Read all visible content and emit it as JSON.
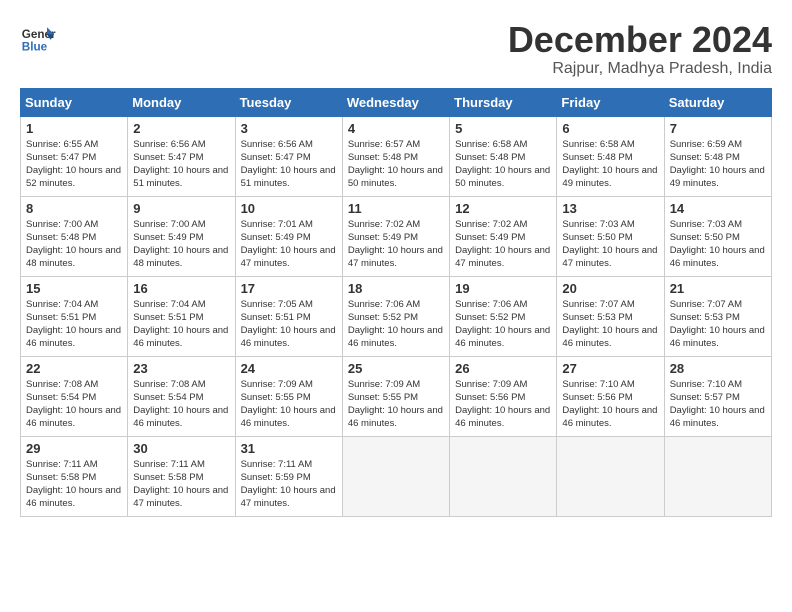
{
  "header": {
    "logo_line1": "General",
    "logo_line2": "Blue",
    "month_title": "December 2024",
    "location": "Rajpur, Madhya Pradesh, India"
  },
  "weekdays": [
    "Sunday",
    "Monday",
    "Tuesday",
    "Wednesday",
    "Thursday",
    "Friday",
    "Saturday"
  ],
  "weeks": [
    [
      {
        "day": "1",
        "sunrise": "6:55 AM",
        "sunset": "5:47 PM",
        "daylight": "10 hours and 52 minutes."
      },
      {
        "day": "2",
        "sunrise": "6:56 AM",
        "sunset": "5:47 PM",
        "daylight": "10 hours and 51 minutes."
      },
      {
        "day": "3",
        "sunrise": "6:56 AM",
        "sunset": "5:47 PM",
        "daylight": "10 hours and 51 minutes."
      },
      {
        "day": "4",
        "sunrise": "6:57 AM",
        "sunset": "5:48 PM",
        "daylight": "10 hours and 50 minutes."
      },
      {
        "day": "5",
        "sunrise": "6:58 AM",
        "sunset": "5:48 PM",
        "daylight": "10 hours and 50 minutes."
      },
      {
        "day": "6",
        "sunrise": "6:58 AM",
        "sunset": "5:48 PM",
        "daylight": "10 hours and 49 minutes."
      },
      {
        "day": "7",
        "sunrise": "6:59 AM",
        "sunset": "5:48 PM",
        "daylight": "10 hours and 49 minutes."
      }
    ],
    [
      {
        "day": "8",
        "sunrise": "7:00 AM",
        "sunset": "5:48 PM",
        "daylight": "10 hours and 48 minutes."
      },
      {
        "day": "9",
        "sunrise": "7:00 AM",
        "sunset": "5:49 PM",
        "daylight": "10 hours and 48 minutes."
      },
      {
        "day": "10",
        "sunrise": "7:01 AM",
        "sunset": "5:49 PM",
        "daylight": "10 hours and 47 minutes."
      },
      {
        "day": "11",
        "sunrise": "7:02 AM",
        "sunset": "5:49 PM",
        "daylight": "10 hours and 47 minutes."
      },
      {
        "day": "12",
        "sunrise": "7:02 AM",
        "sunset": "5:49 PM",
        "daylight": "10 hours and 47 minutes."
      },
      {
        "day": "13",
        "sunrise": "7:03 AM",
        "sunset": "5:50 PM",
        "daylight": "10 hours and 47 minutes."
      },
      {
        "day": "14",
        "sunrise": "7:03 AM",
        "sunset": "5:50 PM",
        "daylight": "10 hours and 46 minutes."
      }
    ],
    [
      {
        "day": "15",
        "sunrise": "7:04 AM",
        "sunset": "5:51 PM",
        "daylight": "10 hours and 46 minutes."
      },
      {
        "day": "16",
        "sunrise": "7:04 AM",
        "sunset": "5:51 PM",
        "daylight": "10 hours and 46 minutes."
      },
      {
        "day": "17",
        "sunrise": "7:05 AM",
        "sunset": "5:51 PM",
        "daylight": "10 hours and 46 minutes."
      },
      {
        "day": "18",
        "sunrise": "7:06 AM",
        "sunset": "5:52 PM",
        "daylight": "10 hours and 46 minutes."
      },
      {
        "day": "19",
        "sunrise": "7:06 AM",
        "sunset": "5:52 PM",
        "daylight": "10 hours and 46 minutes."
      },
      {
        "day": "20",
        "sunrise": "7:07 AM",
        "sunset": "5:53 PM",
        "daylight": "10 hours and 46 minutes."
      },
      {
        "day": "21",
        "sunrise": "7:07 AM",
        "sunset": "5:53 PM",
        "daylight": "10 hours and 46 minutes."
      }
    ],
    [
      {
        "day": "22",
        "sunrise": "7:08 AM",
        "sunset": "5:54 PM",
        "daylight": "10 hours and 46 minutes."
      },
      {
        "day": "23",
        "sunrise": "7:08 AM",
        "sunset": "5:54 PM",
        "daylight": "10 hours and 46 minutes."
      },
      {
        "day": "24",
        "sunrise": "7:09 AM",
        "sunset": "5:55 PM",
        "daylight": "10 hours and 46 minutes."
      },
      {
        "day": "25",
        "sunrise": "7:09 AM",
        "sunset": "5:55 PM",
        "daylight": "10 hours and 46 minutes."
      },
      {
        "day": "26",
        "sunrise": "7:09 AM",
        "sunset": "5:56 PM",
        "daylight": "10 hours and 46 minutes."
      },
      {
        "day": "27",
        "sunrise": "7:10 AM",
        "sunset": "5:56 PM",
        "daylight": "10 hours and 46 minutes."
      },
      {
        "day": "28",
        "sunrise": "7:10 AM",
        "sunset": "5:57 PM",
        "daylight": "10 hours and 46 minutes."
      }
    ],
    [
      {
        "day": "29",
        "sunrise": "7:11 AM",
        "sunset": "5:58 PM",
        "daylight": "10 hours and 46 minutes."
      },
      {
        "day": "30",
        "sunrise": "7:11 AM",
        "sunset": "5:58 PM",
        "daylight": "10 hours and 47 minutes."
      },
      {
        "day": "31",
        "sunrise": "7:11 AM",
        "sunset": "5:59 PM",
        "daylight": "10 hours and 47 minutes."
      },
      null,
      null,
      null,
      null
    ]
  ],
  "labels": {
    "sunrise": "Sunrise:",
    "sunset": "Sunset:",
    "daylight": "Daylight:"
  }
}
